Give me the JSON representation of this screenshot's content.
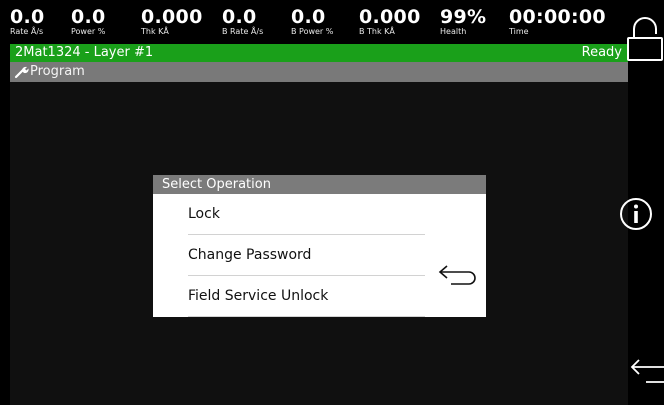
{
  "metrics": [
    {
      "value": "0.0",
      "label": "Rate Å/s"
    },
    {
      "value": "0.0",
      "label": "Power %"
    },
    {
      "value": "0.000",
      "label": "Thk KÅ"
    },
    {
      "value": "0.0",
      "label": "B Rate Å/s"
    },
    {
      "value": "0.0",
      "label": "B Power %"
    },
    {
      "value": "0.000",
      "label": "B Thk KÅ"
    },
    {
      "value": "99%",
      "label": "Health"
    },
    {
      "value": "00:00:00",
      "label": "Time"
    }
  ],
  "status": {
    "title": "2Mat1324 - Layer #1",
    "state": "Ready",
    "color": "#1aa01a"
  },
  "mode": {
    "icon": "wrench-icon",
    "label": "Program"
  },
  "dialog": {
    "title": "Select Operation",
    "items": [
      "Lock",
      "Change Password",
      "Field Service Unlock"
    ],
    "back_icon": "back-arrow-icon"
  },
  "sidebar": {
    "icons": [
      "lock-icon",
      "info-icon",
      "back-arrow-icon"
    ]
  }
}
